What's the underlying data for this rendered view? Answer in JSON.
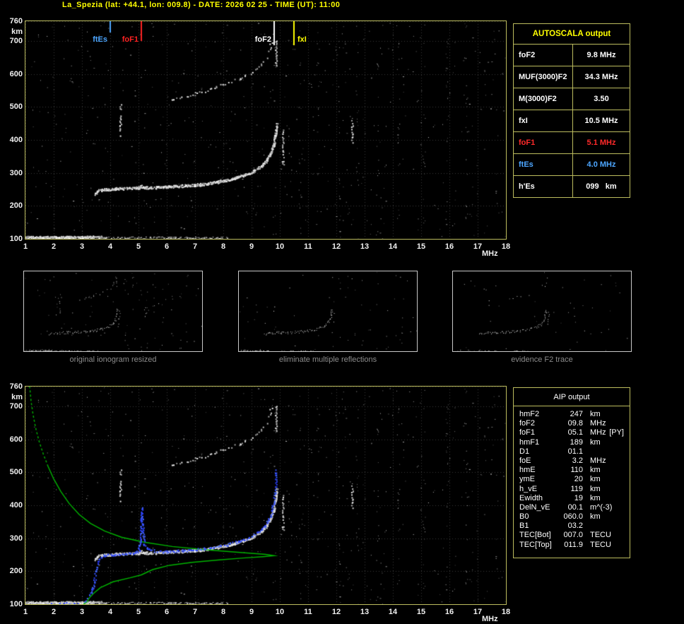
{
  "header": {
    "title": "La_Spezia (lat: +44.1, lon: 009.8) - DATE: 2026 02 25 - TIME (UT): 11:00"
  },
  "colors": {
    "frame": "#bcbc5e",
    "title_text": "#ffff00",
    "axis_text": "#f0f0f0",
    "caption_text": "#8c8c8c",
    "green_profile": "#00b400",
    "blue_trace": "#3c64ff",
    "red": "#ff2a2a",
    "blue_label": "#4da6ff"
  },
  "autoscala": {
    "title": "AUTOSCALA output",
    "rows": [
      {
        "label": "foF2",
        "value": "9.8 MHz",
        "color": "#ffffff"
      },
      {
        "label": "MUF(3000)F2",
        "value": "34.3 MHz",
        "color": "#ffffff"
      },
      {
        "label": "M(3000)F2",
        "value": "3.50",
        "color": "#ffffff"
      },
      {
        "label": "fxI",
        "value": "10.5 MHz",
        "color": "#ffffff"
      },
      {
        "label": "foF1",
        "value": "5.1 MHz",
        "color": "#ff2a2a"
      },
      {
        "label": "ftEs",
        "value": "4.0 MHz",
        "color": "#4da6ff"
      },
      {
        "label": "h'Es",
        "value": "099   km",
        "color": "#ffffff"
      }
    ]
  },
  "aip": {
    "title": "AIP output",
    "rows": [
      {
        "label": "hmF2",
        "value": "247",
        "unit": "km",
        "extra": ""
      },
      {
        "label": "foF2",
        "value": "09.8",
        "unit": "MHz",
        "extra": ""
      },
      {
        "label": "foF1",
        "value": "05.1",
        "unit": "MHz",
        "extra": "[PY]"
      },
      {
        "label": "hmF1",
        "value": "189",
        "unit": "km",
        "extra": ""
      },
      {
        "label": "D1",
        "value": "01.1",
        "unit": "",
        "extra": ""
      },
      {
        "label": "foE",
        "value": "3.2",
        "unit": "MHz",
        "extra": ""
      },
      {
        "label": "hmE",
        "value": "110",
        "unit": "km",
        "extra": ""
      },
      {
        "label": "ymE",
        "value": "20",
        "unit": "km",
        "extra": ""
      },
      {
        "label": "h_vE",
        "value": "119",
        "unit": "km",
        "extra": ""
      },
      {
        "label": "Ewidth",
        "value": "19",
        "unit": "km",
        "extra": ""
      },
      {
        "label": "DelN_vE",
        "value": "00.1",
        "unit": "m^(-3)",
        "extra": ""
      },
      {
        "label": "B0",
        "value": "060.0",
        "unit": "km",
        "extra": ""
      },
      {
        "label": "B1",
        "value": "03.2",
        "unit": "",
        "extra": ""
      },
      {
        "label": "TEC[Bot]",
        "value": "007.0",
        "unit": "TECU",
        "extra": ""
      },
      {
        "label": "TEC[Top]",
        "value": "011.9",
        "unit": "TECU",
        "extra": ""
      }
    ]
  },
  "thumbnails": [
    {
      "caption": "original ionogram resized",
      "show": {
        "es": 1,
        "f": 1,
        "hop": 1,
        "streaks": 1,
        "noise": 0.9
      }
    },
    {
      "caption": "eliminate multiple reflections",
      "show": {
        "es": 1,
        "f": 1,
        "hop": 0,
        "streaks": 0.4,
        "noise": 0.55
      }
    },
    {
      "caption": "evidence F2 trace",
      "show": {
        "es": 0.25,
        "f": 1,
        "hop": 0.45,
        "streaks": 0.5,
        "noise": 0.3
      }
    }
  ],
  "chart_data": [
    {
      "id": "main_ionogram",
      "type": "scatter",
      "xlabel": "MHz",
      "ylabel": "km",
      "xlim": [
        1,
        18
      ],
      "ylim": [
        100,
        760
      ],
      "xticks": [
        1,
        2,
        3,
        4,
        5,
        6,
        7,
        8,
        9,
        10,
        11,
        12,
        13,
        14,
        15,
        16,
        17,
        18
      ],
      "yticks": [
        100,
        200,
        300,
        400,
        500,
        600,
        700,
        760
      ],
      "grid": true,
      "markers": [
        {
          "label": "ftEs",
          "freq": 4.0,
          "color": "#4da6ff"
        },
        {
          "label": "foF1",
          "freq": 5.1,
          "color": "#ff2222"
        },
        {
          "label": "foF2",
          "freq": 9.8,
          "color": "#ffffff"
        },
        {
          "label": "fxI",
          "freq": 10.5,
          "color": "#ffff00"
        }
      ],
      "traces": {
        "es_layer": [
          [
            1.0,
            106
          ],
          [
            1.5,
            106
          ],
          [
            2.0,
            106
          ],
          [
            2.5,
            106
          ],
          [
            3.0,
            106
          ],
          [
            3.3,
            107
          ],
          [
            3.65,
            107
          ]
        ],
        "es_sparse": [
          [
            3.7,
            103
          ],
          [
            5.0,
            103
          ],
          [
            6.5,
            102
          ],
          [
            8.0,
            102
          ]
        ],
        "f_layer": [
          [
            3.45,
            236
          ],
          [
            3.55,
            247
          ],
          [
            3.8,
            251
          ],
          [
            4.2,
            253
          ],
          [
            4.7,
            255
          ],
          [
            5.0,
            256
          ],
          [
            5.08,
            261
          ],
          [
            5.2,
            257
          ],
          [
            5.6,
            257
          ],
          [
            6.0,
            259
          ],
          [
            6.4,
            261
          ],
          [
            6.8,
            263
          ],
          [
            7.2,
            266
          ],
          [
            7.6,
            271
          ],
          [
            8.0,
            277
          ],
          [
            8.4,
            285
          ],
          [
            8.8,
            296
          ],
          [
            9.1,
            308
          ],
          [
            9.35,
            323
          ],
          [
            9.55,
            342
          ],
          [
            9.68,
            363
          ],
          [
            9.78,
            390
          ],
          [
            9.84,
            420
          ],
          [
            9.88,
            450
          ]
        ],
        "f_second_hop": [
          [
            6.2,
            522
          ],
          [
            6.7,
            534
          ],
          [
            7.2,
            547
          ],
          [
            7.7,
            560
          ],
          [
            8.2,
            575
          ],
          [
            8.6,
            590
          ],
          [
            9.0,
            607
          ],
          [
            9.3,
            626
          ],
          [
            9.5,
            648
          ],
          [
            9.62,
            675
          ],
          [
            9.7,
            705
          ]
        ],
        "streaks": [
          {
            "freq": 4.35,
            "h": [
              415,
              515
            ]
          },
          {
            "freq": 10.1,
            "h": [
              325,
              430
            ]
          },
          {
            "freq": 9.85,
            "h": [
              620,
              706
            ]
          },
          {
            "freq": 12.55,
            "h": [
              395,
              460
            ]
          }
        ]
      },
      "noise": {
        "random": 520,
        "bottom_band": 240,
        "rfi_columns": [
          10.7,
          11.35,
          12.1,
          12.75,
          13.45,
          14.2,
          15.1,
          15.9,
          16.6
        ]
      }
    },
    {
      "id": "profile_ionogram",
      "type": "scatter",
      "base_traces": "main_ionogram",
      "xlabel": "MHz",
      "ylabel": "km",
      "xlim": [
        1,
        18
      ],
      "ylim": [
        100,
        760
      ],
      "xticks": [
        1,
        2,
        3,
        4,
        5,
        6,
        7,
        8,
        9,
        10,
        11,
        12,
        13,
        14,
        15,
        16,
        17,
        18
      ],
      "yticks": [
        100,
        200,
        300,
        400,
        500,
        600,
        700,
        760
      ],
      "grid": true,
      "profile": {
        "color": "#00b400",
        "points": [
          [
            3.05,
            100
          ],
          [
            3.1,
            103
          ],
          [
            3.18,
            107
          ],
          [
            3.2,
            110
          ],
          [
            3.25,
            118
          ],
          [
            3.4,
            132
          ],
          [
            3.65,
            150
          ],
          [
            4.1,
            168
          ],
          [
            4.7,
            180
          ],
          [
            5.1,
            189
          ],
          [
            5.5,
            205
          ],
          [
            6.1,
            218
          ],
          [
            6.9,
            227
          ],
          [
            7.8,
            234
          ],
          [
            8.7,
            240
          ],
          [
            9.4,
            244
          ],
          [
            9.8,
            247
          ],
          [
            9.5,
            251
          ],
          [
            8.6,
            257
          ],
          [
            7.4,
            265
          ],
          [
            6.2,
            275
          ],
          [
            5.2,
            288
          ],
          [
            4.4,
            303
          ],
          [
            3.8,
            322
          ],
          [
            3.3,
            345
          ],
          [
            2.9,
            372
          ],
          [
            2.55,
            405
          ],
          [
            2.25,
            442
          ],
          [
            2.0,
            480
          ],
          [
            1.8,
            518
          ],
          [
            1.63,
            556
          ],
          [
            1.48,
            595
          ],
          [
            1.36,
            635
          ],
          [
            1.27,
            675
          ],
          [
            1.2,
            715
          ],
          [
            1.15,
            760
          ]
        ]
      },
      "restored_trace": {
        "color": "#3c64ff",
        "points": [
          [
            3.15,
            112
          ],
          [
            3.3,
            135
          ],
          [
            3.42,
            168
          ],
          [
            3.5,
            205
          ],
          [
            3.58,
            235
          ],
          [
            3.75,
            248
          ],
          [
            4.1,
            252
          ],
          [
            4.5,
            254
          ],
          [
            4.85,
            257
          ],
          [
            5.0,
            263
          ],
          [
            5.04,
            290
          ],
          [
            5.07,
            325
          ],
          [
            5.09,
            358
          ],
          [
            5.1,
            392
          ],
          [
            5.12,
            358
          ],
          [
            5.15,
            315
          ],
          [
            5.2,
            283
          ],
          [
            5.35,
            268
          ],
          [
            5.7,
            260
          ],
          [
            6.1,
            261
          ],
          [
            6.5,
            263
          ],
          [
            6.9,
            266
          ],
          [
            7.3,
            270
          ],
          [
            7.7,
            275
          ],
          [
            8.1,
            281
          ],
          [
            8.5,
            290
          ],
          [
            8.9,
            303
          ],
          [
            9.2,
            318
          ],
          [
            9.45,
            337
          ],
          [
            9.6,
            358
          ],
          [
            9.72,
            385
          ],
          [
            9.8,
            425
          ],
          [
            9.84,
            470
          ],
          [
            9.86,
            510
          ]
        ],
        "es_points": [
          [
            1.75,
            103
          ],
          [
            2.2,
            104
          ],
          [
            2.7,
            104
          ],
          [
            3.05,
            106
          ]
        ]
      }
    }
  ]
}
